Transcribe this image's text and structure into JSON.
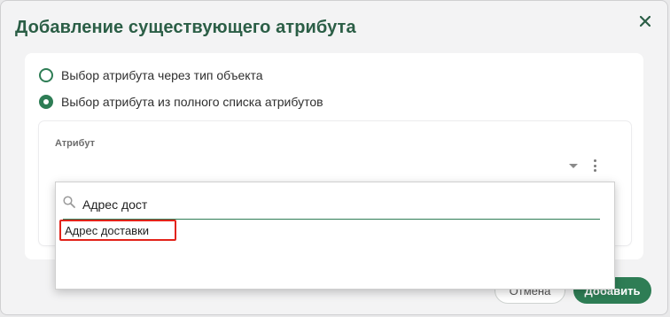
{
  "dialog": {
    "title": "Добавление существующего атрибута",
    "options": [
      {
        "label": "Выбор атрибута через тип объекта",
        "checked": false
      },
      {
        "label": "Выбор атрибута из полного списка атрибутов",
        "checked": true
      }
    ],
    "attribute": {
      "label": "Атрибут"
    },
    "buttons": {
      "cancel": "Отмена",
      "add": "Добавить"
    }
  },
  "dropdown": {
    "search_value": "Адрес дост",
    "results": [
      "Адрес доставки"
    ]
  },
  "colors": {
    "accent": "#2e7d55",
    "title": "#2b5e46",
    "highlight": "#e2231a"
  }
}
